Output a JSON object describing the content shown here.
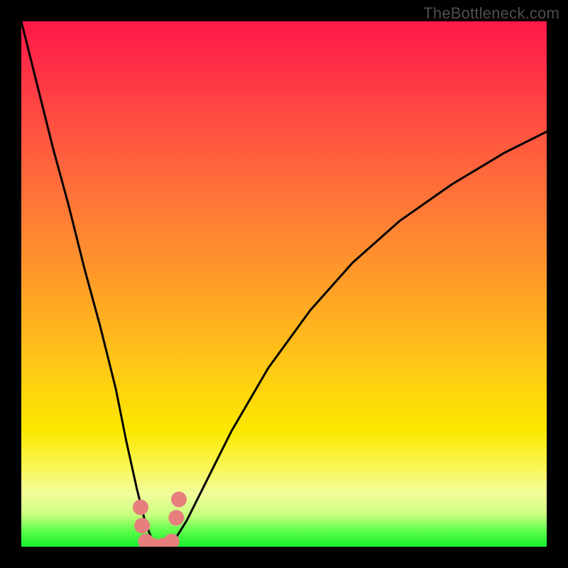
{
  "watermark": "TheBottleneck.com",
  "chart_data": {
    "type": "line",
    "title": "",
    "xlabel": "",
    "ylabel": "",
    "xlim": [
      0,
      100
    ],
    "ylim": [
      0,
      100
    ],
    "grid": false,
    "legend": false,
    "annotations": [],
    "background_gradient": {
      "top_color": "#ff1948",
      "bottom_color": "#16ee2e",
      "meaning": "red high / green low"
    },
    "series": [
      {
        "name": "curve",
        "color": "#000000",
        "x": [
          0,
          3,
          6,
          9,
          12,
          15,
          18,
          20,
          22,
          23.5,
          25,
          26,
          27.5,
          29,
          31.5,
          35,
          40,
          47,
          55,
          63,
          72,
          82,
          92,
          100
        ],
        "y": [
          100,
          88,
          76,
          65,
          53,
          42,
          30,
          20,
          11,
          5,
          1,
          0,
          0,
          1,
          5,
          12,
          22,
          34,
          45,
          54,
          62,
          69,
          75,
          79
        ]
      }
    ],
    "markers": [
      {
        "name": "left-flank",
        "color": "#e77f7e",
        "x": 22.7,
        "y": 7.5
      },
      {
        "name": "left-edge",
        "color": "#e77f7e",
        "x": 23.0,
        "y": 4.0
      },
      {
        "name": "valley-left",
        "color": "#e77f7e",
        "x": 23.7,
        "y": 1.0
      },
      {
        "name": "valley-mid-l",
        "color": "#e77f7e",
        "x": 25.0,
        "y": 0.2
      },
      {
        "name": "valley-mid-r",
        "color": "#e77f7e",
        "x": 27.0,
        "y": 0.2
      },
      {
        "name": "valley-right",
        "color": "#e77f7e",
        "x": 28.6,
        "y": 1.0
      },
      {
        "name": "right-edge",
        "color": "#e77f7e",
        "x": 29.5,
        "y": 5.5
      },
      {
        "name": "right-flank",
        "color": "#e77f7e",
        "x": 30.0,
        "y": 9.0
      }
    ]
  }
}
